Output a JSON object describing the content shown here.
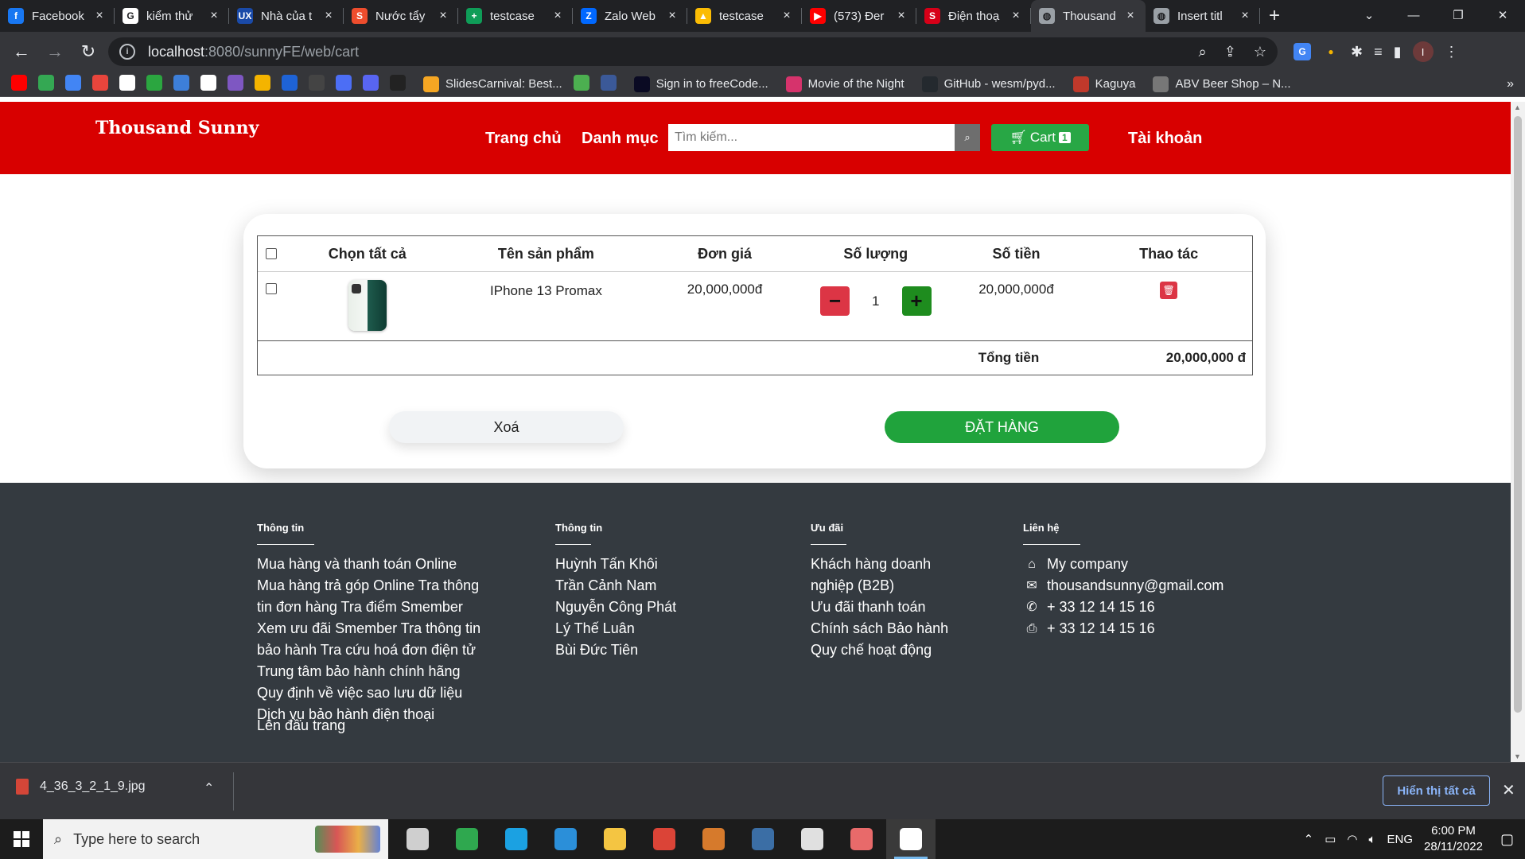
{
  "browser": {
    "tabs": [
      {
        "title": "Facebook",
        "icon": "facebook-icon",
        "color": "#1877f2",
        "glyph": "f",
        "active": false
      },
      {
        "title": "kiểm thử",
        "icon": "google-icon",
        "color": "#ffffff",
        "glyph": "G",
        "active": false
      },
      {
        "title": "Nhà của t",
        "icon": "ux-icon",
        "color": "#1a4aa8",
        "glyph": "UX",
        "active": false
      },
      {
        "title": "Nước tẩy",
        "icon": "shopee-icon",
        "color": "#ee4d2d",
        "glyph": "S",
        "active": false
      },
      {
        "title": "testcase",
        "icon": "sheets-icon",
        "color": "#0f9d58",
        "glyph": "+",
        "active": false
      },
      {
        "title": "Zalo Web",
        "icon": "zalo-icon",
        "color": "#0068ff",
        "glyph": "Z",
        "active": false
      },
      {
        "title": "testcase",
        "icon": "drive-icon",
        "color": "#fbbc04",
        "glyph": "▲",
        "active": false
      },
      {
        "title": "(573) Đer",
        "icon": "youtube-icon",
        "color": "#ff0000",
        "glyph": "▶",
        "active": false
      },
      {
        "title": "Điện thoạ",
        "icon": "s-red-icon",
        "color": "#d70018",
        "glyph": "S",
        "active": false
      },
      {
        "title": "Thousand",
        "icon": "globe-icon",
        "color": "#9aa0a6",
        "glyph": "◍",
        "active": true
      },
      {
        "title": "Insert titl",
        "icon": "globe-icon",
        "color": "#9aa0a6",
        "glyph": "◍",
        "active": false
      }
    ],
    "url_host": "localhost",
    "url_path": ":8080/sunnyFE/web/cart",
    "bookmarks": [
      {
        "label": "",
        "icon": "youtube-bookmark-icon",
        "color": "#ff0000"
      },
      {
        "label": "",
        "icon": "maps-bookmark-icon",
        "color": "#34a853"
      },
      {
        "label": "",
        "icon": "translate-bookmark-icon",
        "color": "#4285f4"
      },
      {
        "label": "",
        "icon": "store-bookmark-icon",
        "color": "#e8453c"
      },
      {
        "label": "",
        "icon": "grid-bookmark-icon",
        "color": "#ffffff"
      },
      {
        "label": "",
        "icon": "play-bookmark-icon",
        "color": "#2ba640"
      },
      {
        "label": "",
        "icon": "wave-bookmark-icon",
        "color": "#3d7fd9"
      },
      {
        "label": "",
        "icon": "ring-bookmark-icon",
        "color": "#ffffff"
      },
      {
        "label": "",
        "icon": "purple-bookmark-icon",
        "color": "#7e57c2"
      },
      {
        "label": "",
        "icon": "yellow-bookmark-icon",
        "color": "#f4b400"
      },
      {
        "label": "",
        "icon": "blue-v-bookmark-icon",
        "color": "#1e63d6"
      },
      {
        "label": "",
        "icon": "dark-bookmark-icon",
        "color": "#444444"
      },
      {
        "label": "",
        "icon": "r-bookmark-icon",
        "color": "#4c6ef5"
      },
      {
        "label": "",
        "icon": "discord-bookmark-icon",
        "color": "#5865f2"
      },
      {
        "label": "",
        "icon": "doc-bookmark-icon",
        "color": "#222222"
      },
      {
        "label": "SlidesCarnival: Best...",
        "icon": "slides-bookmark-icon",
        "color": "#f5a623"
      },
      {
        "label": "",
        "icon": "green-circle-bookmark-icon",
        "color": "#4caf50"
      },
      {
        "label": "",
        "icon": "p-bookmark-icon",
        "color": "#3b5998"
      },
      {
        "label": "Sign in to freeCode...",
        "icon": "freecodecamp-bookmark-icon",
        "color": "#0a0a23"
      },
      {
        "label": "Movie of the Night",
        "icon": "movie-bookmark-icon",
        "color": "#d6336c"
      },
      {
        "label": "GitHub - wesm/pyd...",
        "icon": "github-bookmark-icon",
        "color": "#24292e"
      },
      {
        "label": "Kaguya",
        "icon": "kaguya-bookmark-icon",
        "color": "#c0392b"
      },
      {
        "label": "ABV Beer Shop – N...",
        "icon": "beer-bookmark-icon",
        "color": "#777777"
      }
    ]
  },
  "site": {
    "brand": "Thousand Sunny",
    "nav_home": "Trang chủ",
    "nav_categories": "Danh mục",
    "search_placeholder": "Tìm kiếm...",
    "cart_label": "Cart",
    "cart_count": "1",
    "account_label": "Tài khoản",
    "header_color": "#d80000"
  },
  "cart": {
    "headers": {
      "select_all": "Chọn tất cả",
      "product_name": "Tên sản phẩm",
      "unit_price": "Đơn giá",
      "quantity": "Số lượng",
      "amount": "Số tiền",
      "actions": "Thao tác"
    },
    "items": [
      {
        "name": "IPhone 13 Promax",
        "unit_price": "20,000,000đ",
        "quantity": "1",
        "amount": "20,000,000đ"
      }
    ],
    "total_label": "Tổng tiền",
    "total_value": "20,000,000 đ",
    "clear_button": "Xoá",
    "order_button": "ĐẶT HÀNG"
  },
  "footer": {
    "col1": {
      "heading": "Thông tin",
      "items": [
        "Mua hàng và thanh toán Online",
        "Mua hàng trả góp Online Tra thông",
        "tin đơn hàng Tra điểm Smember",
        "Xem ưu đãi Smember Tra thông tin",
        "bảo hành Tra cứu hoá đơn điện tử",
        "Trung tâm bảo hành chính hãng",
        "Quy định về việc sao lưu dữ liệu",
        "Dịch vụ bảo hành điện thoại"
      ]
    },
    "col2": {
      "heading": "Thông tin",
      "items": [
        "Huỳnh Tấn Khôi",
        "Trần Cảnh Nam",
        "Nguyễn Công Phát",
        "Lý Thế Luân",
        "Bùi Đức Tiên"
      ]
    },
    "col3": {
      "heading": "Ưu đãi",
      "items": [
        "Khách hàng doanh",
        "nghiệp (B2B)",
        "Ưu đãi thanh toán",
        "Chính sách Bảo hành",
        "Quy chế hoạt động"
      ]
    },
    "col4": {
      "heading": "Liên hệ",
      "company": "My company",
      "email": "thousandsunny@gmail.com",
      "phone": "+ 33 12 14 15 16",
      "fax": "+ 33 12 14 15 16"
    },
    "back_to_top": "Lên đầu trang",
    "bg_color": "#343a40"
  },
  "downloads": {
    "file_name": "4_36_3_2_1_9.jpg",
    "show_all": "Hiển thị tất cả"
  },
  "taskbar": {
    "search_placeholder": "Type here to search",
    "language": "ENG",
    "time": "6:00 PM",
    "date": "28/11/2022",
    "apps": [
      {
        "icon": "task-view-icon",
        "color": "#cfcfcf",
        "active": false
      },
      {
        "icon": "snipping-tool-icon",
        "color": "#2fa84f",
        "active": false
      },
      {
        "icon": "edge-icon",
        "color": "#1ba1e2",
        "active": false
      },
      {
        "icon": "vscode-icon",
        "color": "#2b8fd9",
        "active": false
      },
      {
        "icon": "file-explorer-icon",
        "color": "#f4c542",
        "active": false
      },
      {
        "icon": "chrome-icon",
        "color": "#db4437",
        "active": false
      },
      {
        "icon": "settings-gear-icon",
        "color": "#d67a2c",
        "active": false
      },
      {
        "icon": "app-blue-icon",
        "color": "#3b6ea5",
        "active": false
      },
      {
        "icon": "calculator-icon",
        "color": "#e0e0e0",
        "active": false
      },
      {
        "icon": "paint-icon",
        "color": "#e86a6a",
        "active": false
      },
      {
        "icon": "photos-icon",
        "color": "#ffffff",
        "active": true
      }
    ]
  }
}
